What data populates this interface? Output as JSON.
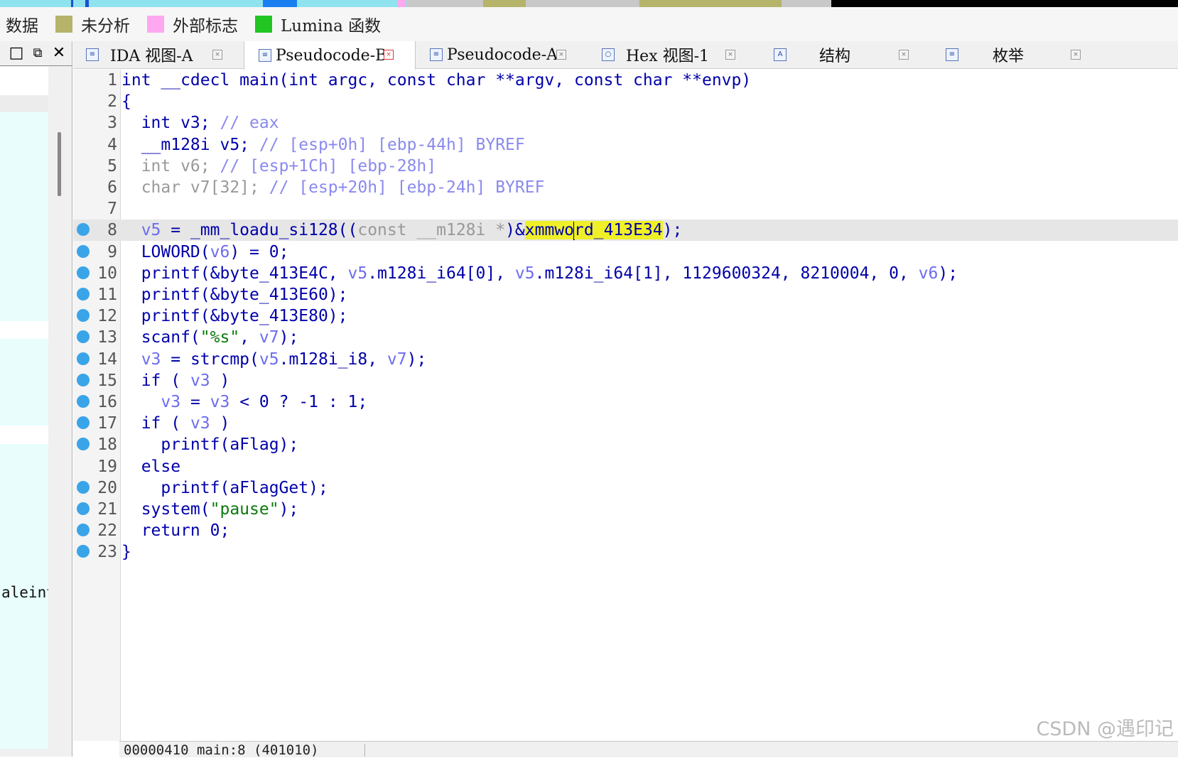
{
  "legend": {
    "items": [
      {
        "label": "数据",
        "color": ""
      },
      {
        "label": "未分析",
        "color": "#b5b46a"
      },
      {
        "label": "外部标志",
        "color": "#ffa7ef"
      },
      {
        "label": "Lumina 函数",
        "color": "#23c523"
      }
    ]
  },
  "left_panel": {
    "visible_text": "aleint"
  },
  "tabs": [
    {
      "label": "IDA 视图-A",
      "icon": "ida-view-icon",
      "active": false
    },
    {
      "label": "Pseudocode-B",
      "icon": "pseudocode-icon",
      "active": true
    },
    {
      "label": "Pseudocode-A",
      "icon": "pseudocode-icon",
      "active": false
    },
    {
      "label": "Hex 视图-1",
      "icon": "hex-view-icon",
      "active": false
    },
    {
      "label": "结构",
      "icon": "structures-icon",
      "active": false
    },
    {
      "label": "枚举",
      "icon": "enums-icon",
      "active": false
    }
  ],
  "code": {
    "highlight_line": 8,
    "lines": [
      {
        "n": "1",
        "bp": false,
        "tokens": [
          {
            "t": "int __cdecl main(int argc, const char **argv, const char **envp)",
            "k": "n"
          }
        ]
      },
      {
        "n": "2",
        "bp": false,
        "tokens": [
          {
            "t": "{",
            "k": "n"
          }
        ]
      },
      {
        "n": "3",
        "bp": false,
        "tokens": [
          {
            "t": "  int v3; ",
            "k": "n"
          },
          {
            "t": "// eax",
            "k": "c"
          }
        ]
      },
      {
        "n": "4",
        "bp": false,
        "tokens": [
          {
            "t": "  __m128i v5; ",
            "k": "n"
          },
          {
            "t": "// [esp+0h] [ebp-44h] BYREF",
            "k": "c"
          }
        ]
      },
      {
        "n": "5",
        "bp": false,
        "tokens": [
          {
            "t": "  int v6; ",
            "k": "g"
          },
          {
            "t": "// [esp+1Ch] [ebp-28h]",
            "k": "c"
          }
        ]
      },
      {
        "n": "6",
        "bp": false,
        "tokens": [
          {
            "t": "  char v7[32]; ",
            "k": "g"
          },
          {
            "t": "// [esp+20h] [ebp-24h] BYREF",
            "k": "c"
          }
        ]
      },
      {
        "n": "7",
        "bp": false,
        "tokens": []
      },
      {
        "n": "8",
        "bp": true,
        "tokens": [
          {
            "t": "  ",
            "k": "n"
          },
          {
            "t": "v5",
            "k": "v"
          },
          {
            "t": " = _mm_loadu_si128((",
            "k": "n"
          },
          {
            "t": "const __m128i *",
            "k": "g"
          },
          {
            "t": ")&",
            "k": "n"
          },
          {
            "t": "xmmwo",
            "k": "y"
          },
          {
            "t": "",
            "k": "caret"
          },
          {
            "t": "rd_413E34",
            "k": "y"
          },
          {
            "t": ");",
            "k": "n"
          }
        ]
      },
      {
        "n": "9",
        "bp": true,
        "tokens": [
          {
            "t": "  LOWORD(",
            "k": "n"
          },
          {
            "t": "v6",
            "k": "v"
          },
          {
            "t": ") = 0;",
            "k": "n"
          }
        ]
      },
      {
        "n": "10",
        "bp": true,
        "tokens": [
          {
            "t": "  printf(&byte_413E4C, ",
            "k": "n"
          },
          {
            "t": "v5",
            "k": "v"
          },
          {
            "t": ".m128i_i64[0], ",
            "k": "n"
          },
          {
            "t": "v5",
            "k": "v"
          },
          {
            "t": ".m128i_i64[1], 1129600324, 8210004, 0, ",
            "k": "n"
          },
          {
            "t": "v6",
            "k": "v"
          },
          {
            "t": ");",
            "k": "n"
          }
        ]
      },
      {
        "n": "11",
        "bp": true,
        "tokens": [
          {
            "t": "  printf(&byte_413E60);",
            "k": "n"
          }
        ]
      },
      {
        "n": "12",
        "bp": true,
        "tokens": [
          {
            "t": "  printf(&byte_413E80);",
            "k": "n"
          }
        ]
      },
      {
        "n": "13",
        "bp": true,
        "tokens": [
          {
            "t": "  scanf(",
            "k": "n"
          },
          {
            "t": "\"%s\"",
            "k": "s"
          },
          {
            "t": ", ",
            "k": "n"
          },
          {
            "t": "v7",
            "k": "v"
          },
          {
            "t": ");",
            "k": "n"
          }
        ]
      },
      {
        "n": "14",
        "bp": true,
        "tokens": [
          {
            "t": "  ",
            "k": "n"
          },
          {
            "t": "v3",
            "k": "v"
          },
          {
            "t": " = strcmp(",
            "k": "n"
          },
          {
            "t": "v5",
            "k": "v"
          },
          {
            "t": ".m128i_i8, ",
            "k": "n"
          },
          {
            "t": "v7",
            "k": "v"
          },
          {
            "t": ");",
            "k": "n"
          }
        ]
      },
      {
        "n": "15",
        "bp": true,
        "tokens": [
          {
            "t": "  if ( ",
            "k": "n"
          },
          {
            "t": "v3",
            "k": "v"
          },
          {
            "t": " )",
            "k": "n"
          }
        ]
      },
      {
        "n": "16",
        "bp": true,
        "tokens": [
          {
            "t": "    ",
            "k": "n"
          },
          {
            "t": "v3",
            "k": "v"
          },
          {
            "t": " = ",
            "k": "n"
          },
          {
            "t": "v3",
            "k": "v"
          },
          {
            "t": " < 0 ? -1 : 1;",
            "k": "n"
          }
        ]
      },
      {
        "n": "17",
        "bp": true,
        "tokens": [
          {
            "t": "  if ( ",
            "k": "n"
          },
          {
            "t": "v3",
            "k": "v"
          },
          {
            "t": " )",
            "k": "n"
          }
        ]
      },
      {
        "n": "18",
        "bp": true,
        "tokens": [
          {
            "t": "    printf(aFlag);",
            "k": "n"
          }
        ]
      },
      {
        "n": "19",
        "bp": false,
        "tokens": [
          {
            "t": "  else",
            "k": "n"
          }
        ]
      },
      {
        "n": "20",
        "bp": true,
        "tokens": [
          {
            "t": "    printf(aFlagGet);",
            "k": "n"
          }
        ]
      },
      {
        "n": "21",
        "bp": true,
        "tokens": [
          {
            "t": "  system(",
            "k": "n"
          },
          {
            "t": "\"pause\"",
            "k": "s"
          },
          {
            "t": ");",
            "k": "n"
          }
        ]
      },
      {
        "n": "22",
        "bp": true,
        "tokens": [
          {
            "t": "  return 0;",
            "k": "n"
          }
        ]
      },
      {
        "n": "23",
        "bp": true,
        "tokens": [
          {
            "t": "}",
            "k": "n"
          }
        ]
      }
    ]
  },
  "status": {
    "text": "00000410 main:8 (401010)"
  },
  "watermark": "CSDN @遇印记",
  "colors": {
    "breakpoint": "#3aa4e9",
    "keyword": "#0000aa",
    "string": "#0b7a0b",
    "comment": "#8a8aee",
    "highlight": "#f0f028"
  }
}
